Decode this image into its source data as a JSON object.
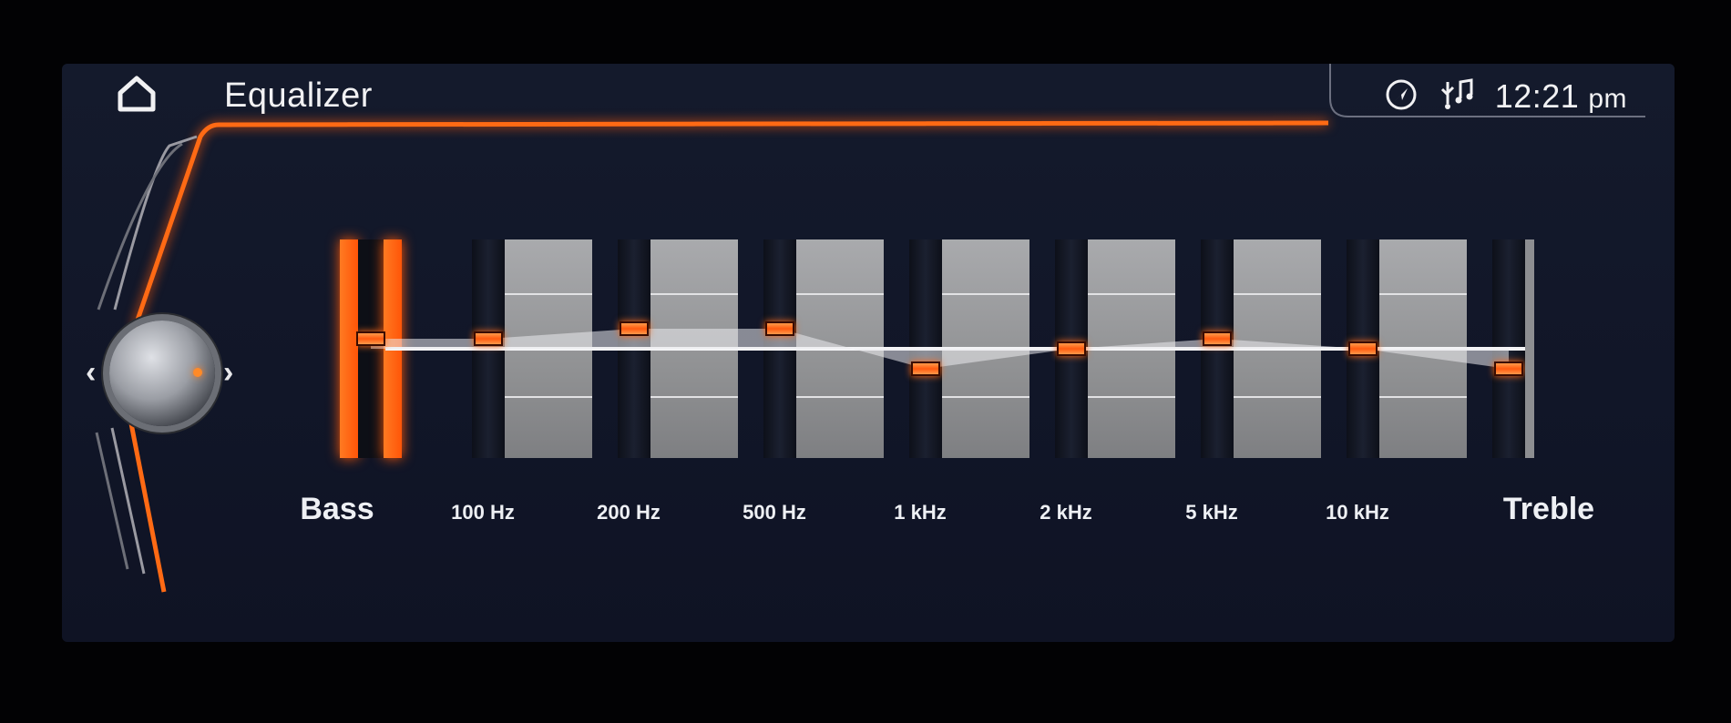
{
  "header": {
    "title": "Equalizer",
    "time": "12:21",
    "ampm": "pm"
  },
  "icons": {
    "home": "home-icon",
    "navigation": "navigation-compass-icon",
    "usb_music": "usb-music-icon"
  },
  "colors": {
    "accent": "#ff6a14",
    "background": "#121729",
    "panel": "#97989b",
    "text": "#f1f1f3"
  },
  "equalizer": {
    "bass_label": "Bass",
    "treble_label": "Treble",
    "bands": [
      {
        "label": "100 Hz",
        "level": 1
      },
      {
        "label": "200 Hz",
        "level": 2
      },
      {
        "label": "500 Hz",
        "level": 2
      },
      {
        "label": "1 kHz",
        "level": -2
      },
      {
        "label": "2 kHz",
        "level": 0
      },
      {
        "label": "5 kHz",
        "level": 1
      },
      {
        "label": "10 kHz",
        "level": 0
      },
      {
        "label": "Treble",
        "level": -2
      }
    ],
    "bass_level": 1,
    "range": [
      -6,
      6
    ]
  }
}
